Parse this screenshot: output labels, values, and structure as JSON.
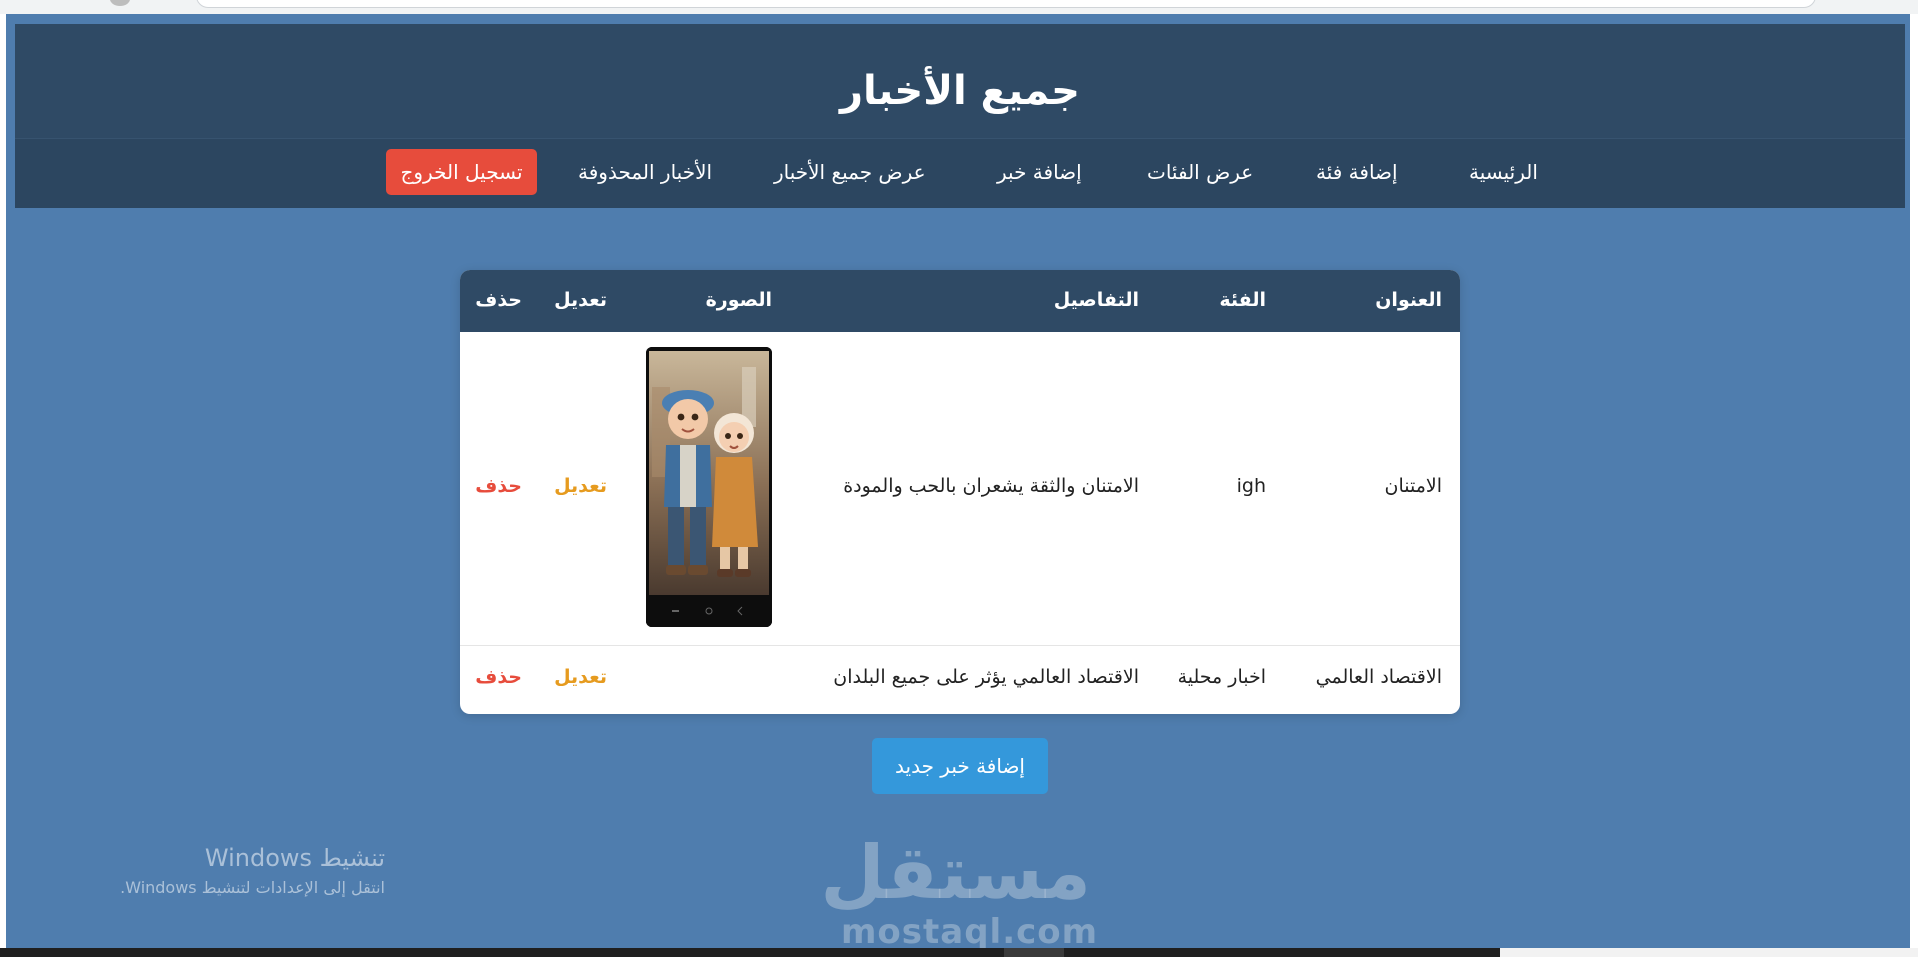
{
  "header": {
    "title": "جميع الأخبار"
  },
  "nav": {
    "items": [
      "الرئيسية",
      "إضافة فئة",
      "عرض الفئات",
      "إضافة خبر",
      "عرض جميع الأخبار",
      "الأخبار المحذوفة"
    ],
    "logout_label": "تسجيل الخروج"
  },
  "table": {
    "columns": [
      "العنوان",
      "الفئة",
      "التفاصيل",
      "الصورة",
      "تعديل",
      "حذف"
    ],
    "rows": [
      {
        "title": "الامتنان",
        "category": "igh",
        "details": "الامتنان والثقة يشعران بالحب والمودة",
        "has_image": true,
        "edit_label": "تعديل",
        "delete_label": "حذف"
      },
      {
        "title": "الاقتصاد العالمي",
        "category": "اخبار محلية",
        "details": "الاقتصاد العالمي يؤثر على جميع البلدان",
        "has_image": false,
        "edit_label": "تعديل",
        "delete_label": "حذف"
      }
    ]
  },
  "actions": {
    "add_news_label": "إضافة خبر جديد"
  },
  "overlay": {
    "windows_activate_title": "تنشيط Windows",
    "windows_activate_subtitle": "انتقل إلى الإعدادات لتنشيط Windows.",
    "watermark_ar": "مستقل",
    "watermark_en": "mostaql.com"
  },
  "colors": {
    "page_bg": "#4f7dae",
    "header_bg": "#2f4a65",
    "logout_bg": "#e74c3c",
    "edit": "#e69b1f",
    "delete": "#e74c3c",
    "primary_button": "#3498db"
  }
}
